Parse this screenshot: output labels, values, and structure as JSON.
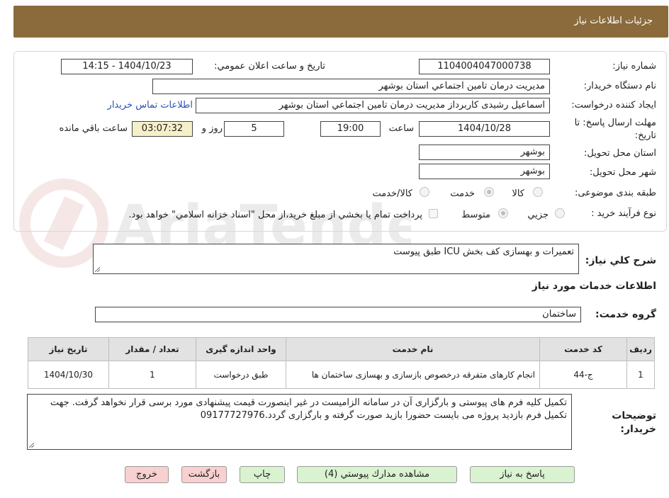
{
  "header": {
    "title": "جزئيات اطلاعات نياز"
  },
  "fields": {
    "need_number_label": "شماره نياز:",
    "need_number": "1104004047000738",
    "announce_label": "تاريخ و ساعت اعلان عمومي:",
    "announce_value": "1404/10/23 - 14:15",
    "buyer_org_label": "نام دستگاه خريدار:",
    "buyer_org": "مديريت درمان تامين اجتماعي استان بوشهر",
    "requester_label": "ايجاد کننده درخواست:",
    "requester": "اسماعيل رشيدی كاربرداز مديريت درمان تامين اجتماعي استان بوشهر",
    "contact_link": "اطلاعات تماس خريدار",
    "deadline_label": "مهلت ارسال پاسخ: تا تاريخ:",
    "deadline_date": "1404/10/28",
    "time_label": "ساعت",
    "deadline_time": "19:00",
    "days_value": "5",
    "days_label": "روز و",
    "remaining_time": "03:07:32",
    "remaining_label": "ساعت باقي مانده",
    "province_label": "استان محل تحويل:",
    "province": "بوشهر",
    "city_label": "شهر محل تحويل:",
    "city": "بوشهر",
    "category_label": "طبقه بندی موضوعی:",
    "category_options": [
      "کالا",
      "خدمت",
      "کالا/خدمت"
    ],
    "process_label": "نوع فرآيند خريد :",
    "process_options": [
      "جزيي",
      "متوسط"
    ],
    "payment_note": "پرداخت تمام يا بخشي از مبلغ خريد،از محل \"اسناد خزانه اسلامي\" خواهد بود."
  },
  "description": {
    "label": "شرح کلي نياز:",
    "value": "تعميرات و بهسازی  کف بخش ICU  طبق پيوست"
  },
  "services": {
    "section_title": "اطلاعات خدمات مورد نياز",
    "group_label": "گروه خدمت:",
    "group_value": "ساختمان",
    "columns": [
      "رديف",
      "کد خدمت",
      "نام خدمت",
      "واحد اندازه گيری",
      "تعداد / مقدار",
      "تاريخ نياز"
    ],
    "rows": [
      [
        "1",
        "ج-44",
        "انجام کارهای متفرقه درخصوص بازسازی و بهسازی ساختمان ها",
        "طبق درخواست",
        "1",
        "1404/10/30"
      ]
    ]
  },
  "buyer_notes": {
    "label": "توضيحات خريدار:",
    "value": "تکميل کليه فرم های پيوستی و بارگزاری آن در سامانه الزاميست در غير اينصورت قيمت پيشنهادی مورد برسی قرار نخواهد گرفت. جهت تکميل فرم بازديد پروژه می بايست حضورا بازيد صورت گرفته و بارگزاری گردد.09177727976"
  },
  "buttons": {
    "reply": "پاسخ به نياز",
    "attachments": "مشاهده مدارك پيوستي (4)",
    "print": "چاپ",
    "back": "بازگشت",
    "exit": "خروج"
  },
  "watermark": "AriaTender.neT",
  "colors": {
    "header": "#8b6b3c",
    "green_button": "#d9f2d0",
    "pink_button": "#f8d0d0",
    "link": "#2a4fb8"
  }
}
